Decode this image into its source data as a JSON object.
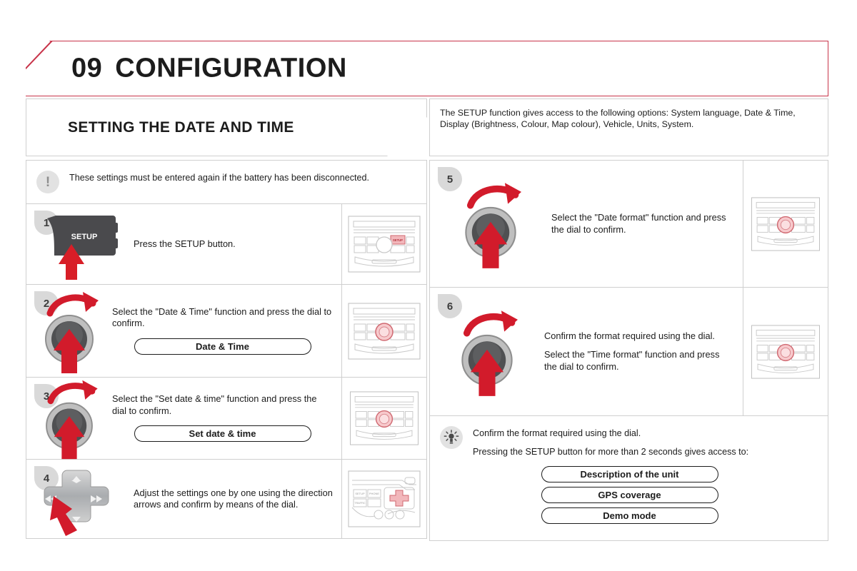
{
  "chapter": {
    "number": "09",
    "title": "CONFIGURATION"
  },
  "section": {
    "title": "SETTING THE DATE AND TIME"
  },
  "intro": {
    "text": "The SETUP function gives access to the following options: System language, Date & Time, Display (Brightness, Colour, Map colour), Vehicle, Units, System."
  },
  "warning": {
    "icon": "exclamation-icon",
    "text": "These settings must be entered again if the battery has been disconnected."
  },
  "steps_left": [
    {
      "number": "1",
      "art": "setup-button-icon",
      "button_label": "SETUP",
      "text": "Press the SETUP button.",
      "pill": null,
      "thumb": "radio-panel-setup-highlight"
    },
    {
      "number": "2",
      "art": "dial-icon",
      "text": "Select the \"Date & Time\" function and press the dial to confirm.",
      "pill": "Date & Time",
      "thumb": "radio-panel-dial-highlight"
    },
    {
      "number": "3",
      "art": "dial-icon",
      "text": "Select the \"Set date & time\" function and press the dial to confirm.",
      "pill": "Set date & time",
      "thumb": "radio-panel-dial-highlight"
    },
    {
      "number": "4",
      "art": "direction-pad-icon",
      "text": "Adjust the settings one by one using the direction arrows and confirm by means of the dial.",
      "pill": null,
      "thumb": "steering-controls-dpad-highlight"
    }
  ],
  "steps_right": [
    {
      "number": "5",
      "art": "dial-icon",
      "text": "Select the \"Date format\" function and press the dial to confirm.",
      "text2": null,
      "thumb": "radio-panel-dial-highlight"
    },
    {
      "number": "6",
      "art": "dial-icon",
      "text": "Confirm the format required using the dial.",
      "text2": "Select the \"Time format\" function and press the dial to confirm.",
      "thumb": "radio-panel-dial-highlight"
    }
  ],
  "tip": {
    "icon": "lightbulb-icon",
    "line1": "Confirm the format required using the dial.",
    "line2": "Pressing the SETUP button for more than 2 seconds gives access to:",
    "options": [
      "Description of the unit",
      "GPS coverage",
      "Demo mode"
    ]
  },
  "colors": {
    "accent_red": "#c8344a",
    "arrow_red": "#d81e27",
    "border_gray": "#cfcfcf",
    "badge_gray": "#d9d9d9",
    "text_dark": "#1c1c1c"
  }
}
